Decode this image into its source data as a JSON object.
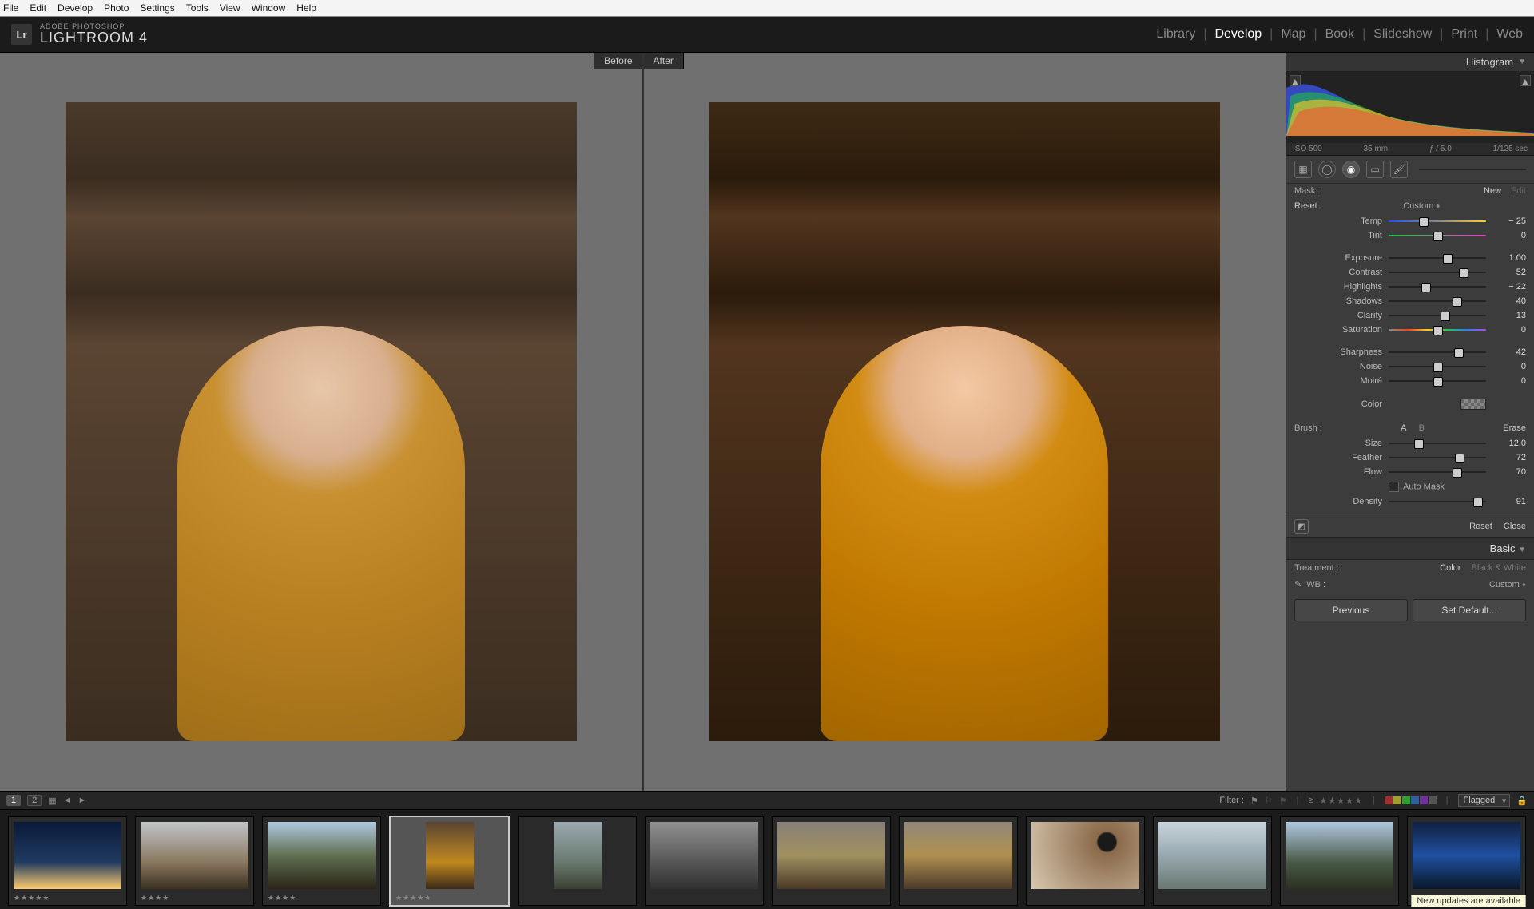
{
  "menubar": [
    "File",
    "Edit",
    "Develop",
    "Photo",
    "Settings",
    "Tools",
    "View",
    "Window",
    "Help"
  ],
  "product": {
    "sup": "ADOBE PHOTOSHOP",
    "main": "LIGHTROOM 4",
    "logo": "Lr"
  },
  "modules": [
    "Library",
    "Develop",
    "Map",
    "Book",
    "Slideshow",
    "Print",
    "Web"
  ],
  "active_module": "Develop",
  "before_after": {
    "before": "Before",
    "after": "After"
  },
  "histogram": {
    "title": "Histogram",
    "iso": "ISO 500",
    "focal": "35 mm",
    "aperture": "ƒ / 5.0",
    "shutter": "1/125 sec"
  },
  "mask": {
    "label": "Mask :",
    "new": "New",
    "edit": "Edit"
  },
  "preset_row": {
    "reset": "Reset",
    "custom": "Custom"
  },
  "sliders": [
    {
      "label": "Temp",
      "val": "− 25",
      "pos": 35,
      "grad": "grad-temp"
    },
    {
      "label": "Tint",
      "val": "0",
      "pos": 50,
      "grad": "grad-tint"
    }
  ],
  "sliders2": [
    {
      "label": "Exposure",
      "val": "1.00",
      "pos": 60
    },
    {
      "label": "Contrast",
      "val": "52",
      "pos": 76
    },
    {
      "label": "Highlights",
      "val": "− 22",
      "pos": 38
    },
    {
      "label": "Shadows",
      "val": "40",
      "pos": 70
    },
    {
      "label": "Clarity",
      "val": "13",
      "pos": 57
    },
    {
      "label": "Saturation",
      "val": "0",
      "pos": 50,
      "grad": "grad-sat"
    }
  ],
  "sliders3": [
    {
      "label": "Sharpness",
      "val": "42",
      "pos": 71
    },
    {
      "label": "Noise",
      "val": "0",
      "pos": 50
    },
    {
      "label": "Moiré",
      "val": "0",
      "pos": 50
    }
  ],
  "color_row": {
    "label": "Color"
  },
  "brush": {
    "label": "Brush :",
    "a": "A",
    "b": "B",
    "erase": "Erase"
  },
  "brush_sliders": [
    {
      "label": "Size",
      "val": "12.0",
      "pos": 30
    },
    {
      "label": "Feather",
      "val": "72",
      "pos": 72
    },
    {
      "label": "Flow",
      "val": "70",
      "pos": 70
    }
  ],
  "automask": "Auto Mask",
  "density": {
    "label": "Density",
    "val": "91",
    "pos": 91
  },
  "bottom_actions": {
    "reset": "Reset",
    "close": "Close"
  },
  "basic_panel": {
    "title": "Basic",
    "treatment": "Treatment :",
    "color": "Color",
    "bw": "Black & White",
    "wb": "WB :",
    "wb_val": "Custom"
  },
  "prev_btn": "Previous",
  "setdef_btn": "Set Default...",
  "filter": {
    "label": "Filter :",
    "flagged": "Flagged"
  },
  "thumbs": [
    {
      "rating": "★★★★★",
      "bg": "linear-gradient(180deg,#0a1a3a,#203a60 60%,#ffcc70)"
    },
    {
      "rating": "★★★★",
      "bg": "linear-gradient(180deg,#c0c4c8,#8a7860 60%,#3a3020)"
    },
    {
      "rating": "★★★★",
      "bg": "linear-gradient(180deg,#b0c8e0,#607050 50%,#2a2418)"
    },
    {
      "rating": "★★★★★",
      "bg": "linear-gradient(180deg,#5a4430,#c08820 60%,#3a2a18)",
      "sel": true,
      "portrait": true
    },
    {
      "rating": "",
      "bg": "linear-gradient(180deg,#9aa8b0,#6a7a70 60%,#3a4030)",
      "portrait": true
    },
    {
      "rating": "",
      "bg": "linear-gradient(180deg,#909090,#606060 50%,#303030)"
    },
    {
      "rating": "",
      "bg": "linear-gradient(180deg,#888078,#a09060 50%,#4a3828)"
    },
    {
      "rating": "",
      "bg": "linear-gradient(180deg,#908878,#b09050 50%,#4a3a28)"
    },
    {
      "rating": "",
      "bg": "radial-gradient(circle at 70% 30%,#1a1a1a 10%,#8a6a4a 12%,#d8c8b0)"
    },
    {
      "rating": "",
      "bg": "linear-gradient(180deg,#c8d4dc,#98a8b0 50%,#6a7870)"
    },
    {
      "rating": "",
      "bg": "linear-gradient(180deg,#b0c8e0,#4a5a48 60%,#2a3020)"
    },
    {
      "rating": "",
      "bg": "linear-gradient(180deg,#102040,#2050a0 50%,#081828)"
    }
  ],
  "status": "New updates are available"
}
